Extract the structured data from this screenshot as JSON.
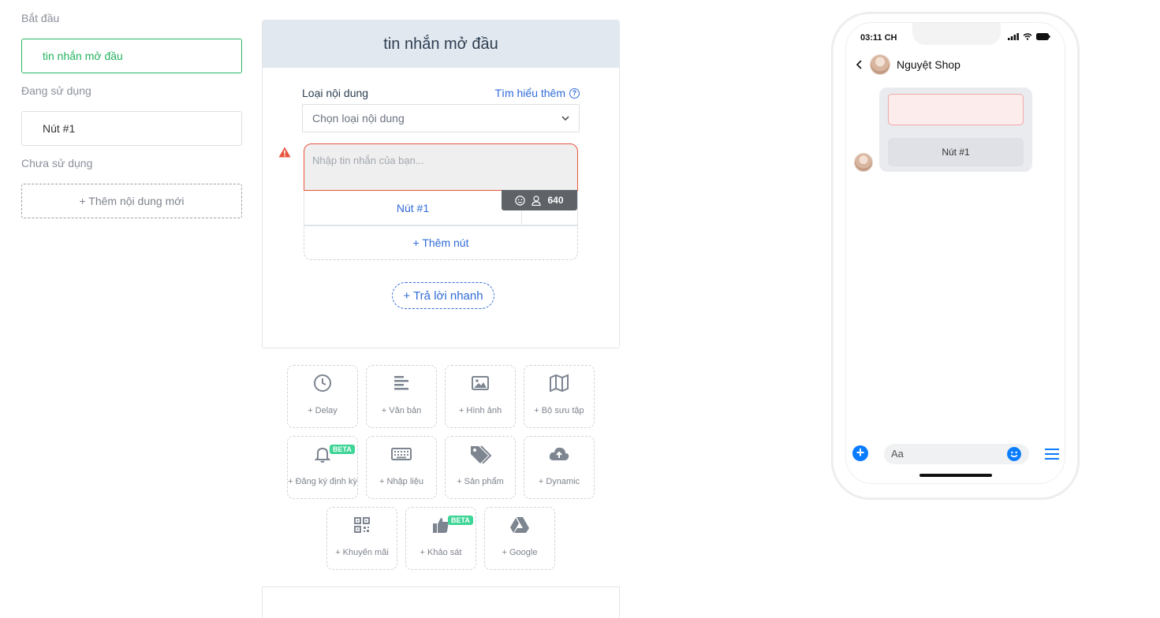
{
  "left_panel": {
    "start_label": "Bắt đầu",
    "start_item": "tin nhắn mở đầu",
    "in_use_label": "Đang sử dụng",
    "in_use_item": "Nút #1",
    "unused_label": "Chưa sử dụng",
    "add_content": "+ Thêm nội dung mới"
  },
  "editor": {
    "title": "tin nhắn mở đầu",
    "content_type_label": "Loại nội dung",
    "learn_more": "Tìm hiểu thêm",
    "select_placeholder": "Chọn loại nội dung",
    "message_placeholder": "Nhập tin nhắn của bạn...",
    "char_count": "640",
    "button_label": "Nút #1",
    "add_button": "+ Thêm nút",
    "quick_reply": "+ Trả lời nhanh"
  },
  "tiles": [
    {
      "label": "+ Delay",
      "icon": "clock-icon"
    },
    {
      "label": "+ Văn bản",
      "icon": "text-lines-icon"
    },
    {
      "label": "+ Hình ảnh",
      "icon": "image-icon"
    },
    {
      "label": "+ Bộ sưu tập",
      "icon": "map-icon"
    },
    {
      "label": "+ Đăng ký định kỳ",
      "icon": "bell-icon",
      "badge": "BETA"
    },
    {
      "label": "+ Nhập liệu",
      "icon": "keyboard-icon"
    },
    {
      "label": "+ Sản phẩm",
      "icon": "tags-icon"
    },
    {
      "label": "+ Dynamic",
      "icon": "cloud-upload-icon"
    },
    {
      "label": "+ Khuyến mãi",
      "icon": "qr-code-icon"
    },
    {
      "label": "+ Khảo sát",
      "icon": "thumbs-up-icon",
      "badge": "BETA"
    },
    {
      "label": "+ Google",
      "icon": "google-drive-icon"
    }
  ],
  "phone": {
    "time": "03:11 CH",
    "shop_name": "Nguyệt Shop",
    "button_label": "Nút #1",
    "input_placeholder": "Aa"
  },
  "colors": {
    "accent_blue": "#2f6bd8",
    "active_green": "#22b35e",
    "error_red": "#e8553e",
    "beta_green": "#3ed597",
    "messenger_blue": "#0a7cff"
  }
}
